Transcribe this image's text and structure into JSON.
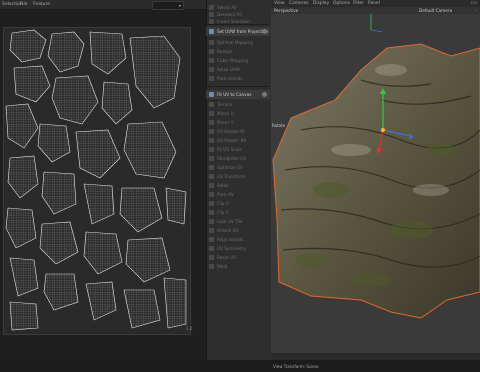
{
  "uv_editor": {
    "menu": [
      "Selection",
      "File",
      "Feature"
    ],
    "dropdown_value": "Project",
    "corner_label": "1.0"
  },
  "command_panel": {
    "items": [
      {
        "label": "Select All",
        "active": false
      },
      {
        "label": "Deselect All",
        "active": false
      },
      {
        "label": "Invert Selection",
        "active": false
      },
      {
        "label": "Set UVW from Projection",
        "active": true
      },
      {
        "label": "Optimal Mapping",
        "active": false
      },
      {
        "label": "Realign",
        "active": false
      },
      {
        "label": "Cubic Mapping",
        "active": false
      },
      {
        "label": "Relax UVW",
        "active": false
      },
      {
        "label": "Pack Islands",
        "active": false
      },
      {
        "label": "Fit UV to Canvas",
        "active": true
      },
      {
        "label": "Terrace",
        "active": false
      },
      {
        "label": "Mirror U",
        "active": false
      },
      {
        "label": "Mirror V",
        "active": false
      },
      {
        "label": "UV Rotate 90",
        "active": false
      },
      {
        "label": "UV Rotate -90",
        "active": false
      },
      {
        "label": "Fit UV Scale",
        "active": false
      },
      {
        "label": "Straighten UV",
        "active": false
      },
      {
        "label": "Optimize UV",
        "active": false
      },
      {
        "label": "UV Transform",
        "active": false
      },
      {
        "label": "Relax",
        "active": false
      },
      {
        "label": "Pack UV",
        "active": false
      },
      {
        "label": "Flip U",
        "active": false
      },
      {
        "label": "Flip V",
        "active": false
      },
      {
        "label": "Lock UV Tile",
        "active": false
      },
      {
        "label": "Unlock UV",
        "active": false
      },
      {
        "label": "Align Islands",
        "active": false
      },
      {
        "label": "UV Symmetry",
        "active": false
      },
      {
        "label": "Reset UV",
        "active": false
      },
      {
        "label": "Weld",
        "active": false
      }
    ]
  },
  "viewport": {
    "menu": [
      "View",
      "Cameras",
      "Display",
      "Options",
      "Filter",
      "Panel"
    ],
    "view_name": "Perspective",
    "camera_name": "Default Camera",
    "side_label": "Rotate",
    "status_text": "View Transform: Scene",
    "colors": {
      "rock_dark": "#3f3a2c",
      "rock_light": "#8a8a78",
      "moss": "#4f5a2a",
      "outline": "#e0682a",
      "background": "#3a3a3a"
    }
  }
}
